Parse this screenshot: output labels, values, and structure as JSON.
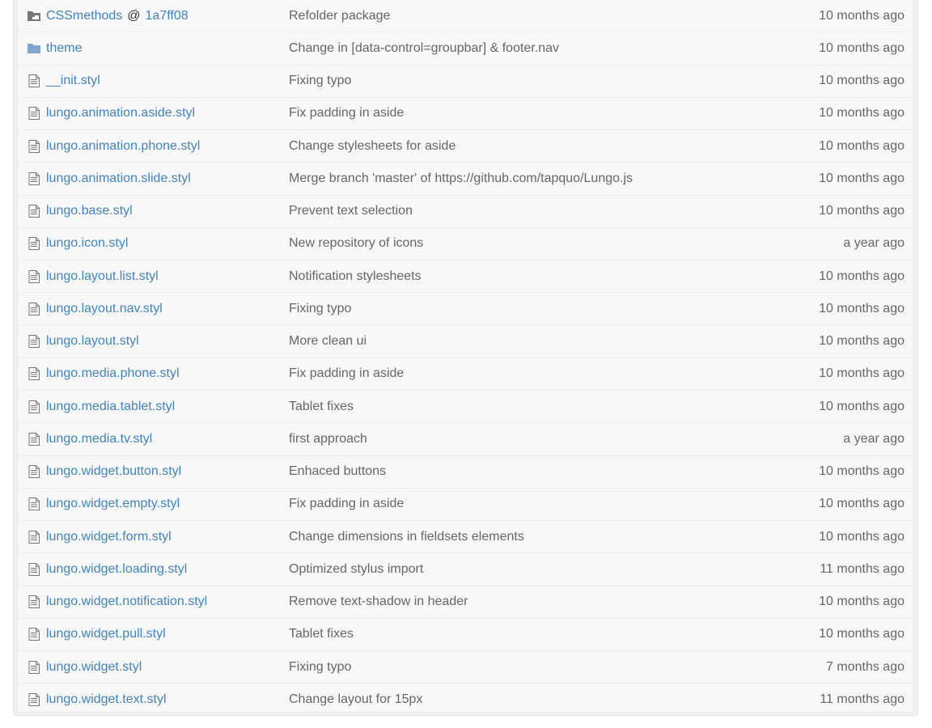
{
  "colors": {
    "link": "#4183c4",
    "muted": "#666666",
    "icon": "#777777",
    "folder": "#80a6cd"
  },
  "rows": [
    {
      "type": "submodule",
      "icon": "submodule-icon",
      "name": "CSSmethods",
      "at": "@",
      "commit": "1a7ff08",
      "message": "Refolder package",
      "age": "10 months ago"
    },
    {
      "type": "folder",
      "icon": "folder-icon",
      "name": "theme",
      "message": "Change in [data-control=groupbar] & footer.nav",
      "age": "10 months ago"
    },
    {
      "type": "file",
      "icon": "file-icon",
      "name": "__init.styl",
      "message": "Fixing typo",
      "age": "10 months ago"
    },
    {
      "type": "file",
      "icon": "file-icon",
      "name": "lungo.animation.aside.styl",
      "message": "Fix padding in aside",
      "age": "10 months ago"
    },
    {
      "type": "file",
      "icon": "file-icon",
      "name": "lungo.animation.phone.styl",
      "message": "Change stylesheets for aside",
      "age": "10 months ago"
    },
    {
      "type": "file",
      "icon": "file-icon",
      "name": "lungo.animation.slide.styl",
      "message": "Merge branch 'master' of https://github.com/tapquo/Lungo.js",
      "age": "10 months ago"
    },
    {
      "type": "file",
      "icon": "file-icon",
      "name": "lungo.base.styl",
      "message": "Prevent text selection",
      "age": "10 months ago"
    },
    {
      "type": "file",
      "icon": "file-icon",
      "name": "lungo.icon.styl",
      "message": "New repository of icons",
      "age": "a year ago"
    },
    {
      "type": "file",
      "icon": "file-icon",
      "name": "lungo.layout.list.styl",
      "message": "Notification stylesheets",
      "age": "10 months ago"
    },
    {
      "type": "file",
      "icon": "file-icon",
      "name": "lungo.layout.nav.styl",
      "message": "Fixing typo",
      "age": "10 months ago"
    },
    {
      "type": "file",
      "icon": "file-icon",
      "name": "lungo.layout.styl",
      "message": "More clean ui",
      "age": "10 months ago"
    },
    {
      "type": "file",
      "icon": "file-icon",
      "name": "lungo.media.phone.styl",
      "message": "Fix padding in aside",
      "age": "10 months ago"
    },
    {
      "type": "file",
      "icon": "file-icon",
      "name": "lungo.media.tablet.styl",
      "message": "Tablet fixes",
      "age": "10 months ago"
    },
    {
      "type": "file",
      "icon": "file-icon",
      "name": "lungo.media.tv.styl",
      "message": "first approach",
      "age": "a year ago"
    },
    {
      "type": "file",
      "icon": "file-icon",
      "name": "lungo.widget.button.styl",
      "message": "Enhaced buttons",
      "age": "10 months ago"
    },
    {
      "type": "file",
      "icon": "file-icon",
      "name": "lungo.widget.empty.styl",
      "message": "Fix padding in aside",
      "age": "10 months ago"
    },
    {
      "type": "file",
      "icon": "file-icon",
      "name": "lungo.widget.form.styl",
      "message": "Change dimensions in fieldsets elements",
      "age": "10 months ago"
    },
    {
      "type": "file",
      "icon": "file-icon",
      "name": "lungo.widget.loading.styl",
      "message": "Optimized stylus import",
      "age": "11 months ago"
    },
    {
      "type": "file",
      "icon": "file-icon",
      "name": "lungo.widget.notification.styl",
      "message": "Remove text-shadow in header",
      "age": "10 months ago"
    },
    {
      "type": "file",
      "icon": "file-icon",
      "name": "lungo.widget.pull.styl",
      "message": "Tablet fixes",
      "age": "10 months ago"
    },
    {
      "type": "file",
      "icon": "file-icon",
      "name": "lungo.widget.styl",
      "message": "Fixing typo",
      "age": "7 months ago"
    },
    {
      "type": "file",
      "icon": "file-icon",
      "name": "lungo.widget.text.styl",
      "message": "Change layout for 15px",
      "age": "11 months ago"
    }
  ]
}
